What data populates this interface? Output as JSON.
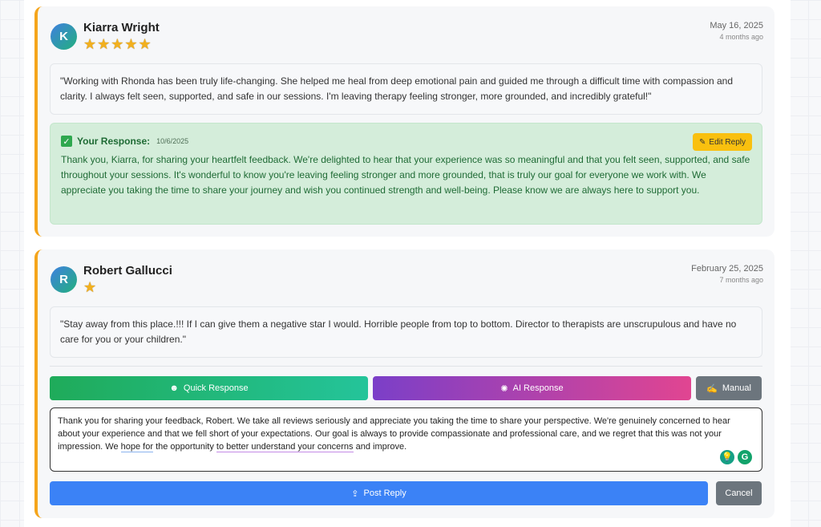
{
  "reviews": [
    {
      "initial": "K",
      "name": "Kiarra Wright",
      "stars": "★★★★★",
      "rating": 5,
      "date": "May 16, 2025",
      "ago": "4 months ago",
      "text": "\"Working with Rhonda has been truly life-changing. She helped me heal from deep emotional pain and guided me through a difficult time with compassion and clarity. I always felt seen, supported, and safe in our sessions. I'm leaving therapy feeling stronger, more grounded, and incredibly grateful!\"",
      "response": {
        "label": "Your Response:",
        "date": "10/6/2025",
        "edit_label": "Edit Reply",
        "text": "Thank you, Kiarra, for sharing your heartfelt feedback. We're delighted to hear that your experience was so meaningful and that you felt seen, supported, and safe throughout your sessions. It's wonderful to know you're leaving feeling stronger and more grounded, that is truly our goal for everyone we work with. We appreciate you taking the time to share your journey and wish you continued strength and well-being. Please know we are always here to support you."
      }
    },
    {
      "initial": "R",
      "name": "Robert Gallucci",
      "stars": "★",
      "rating": 1,
      "date": "February 25, 2025",
      "ago": "7 months ago",
      "text": "\"Stay away from this place.!!! If I can give them a negative star I would. Horrible people from top to bottom. Director to therapists are unscrupulous and have no care for you or your children.\"",
      "actions": {
        "quick": "Quick Response",
        "ai": "AI Response",
        "manual": "Manual"
      },
      "draft": {
        "part1": "Thank you for sharing your feedback, Robert. We take all reviews seriously and appreciate you taking the time to share your perspective. We're genuinely concerned to hear about your experience and that we fell short of your expectations. Our goal is always to provide compassionate and professional care, and we regret that this was not your impression. We ",
        "underline1": "hope for",
        "part2": " the opportunity ",
        "underline2": "to better understand your concerns",
        "part3": " and improve."
      },
      "post_label": "Post Reply",
      "cancel_label": "Cancel"
    }
  ],
  "colors": {
    "accent_border": "#f5a51b",
    "response_bg": "#d4edda",
    "post_button": "#3b82f6",
    "edit_button": "#f9c00f"
  }
}
